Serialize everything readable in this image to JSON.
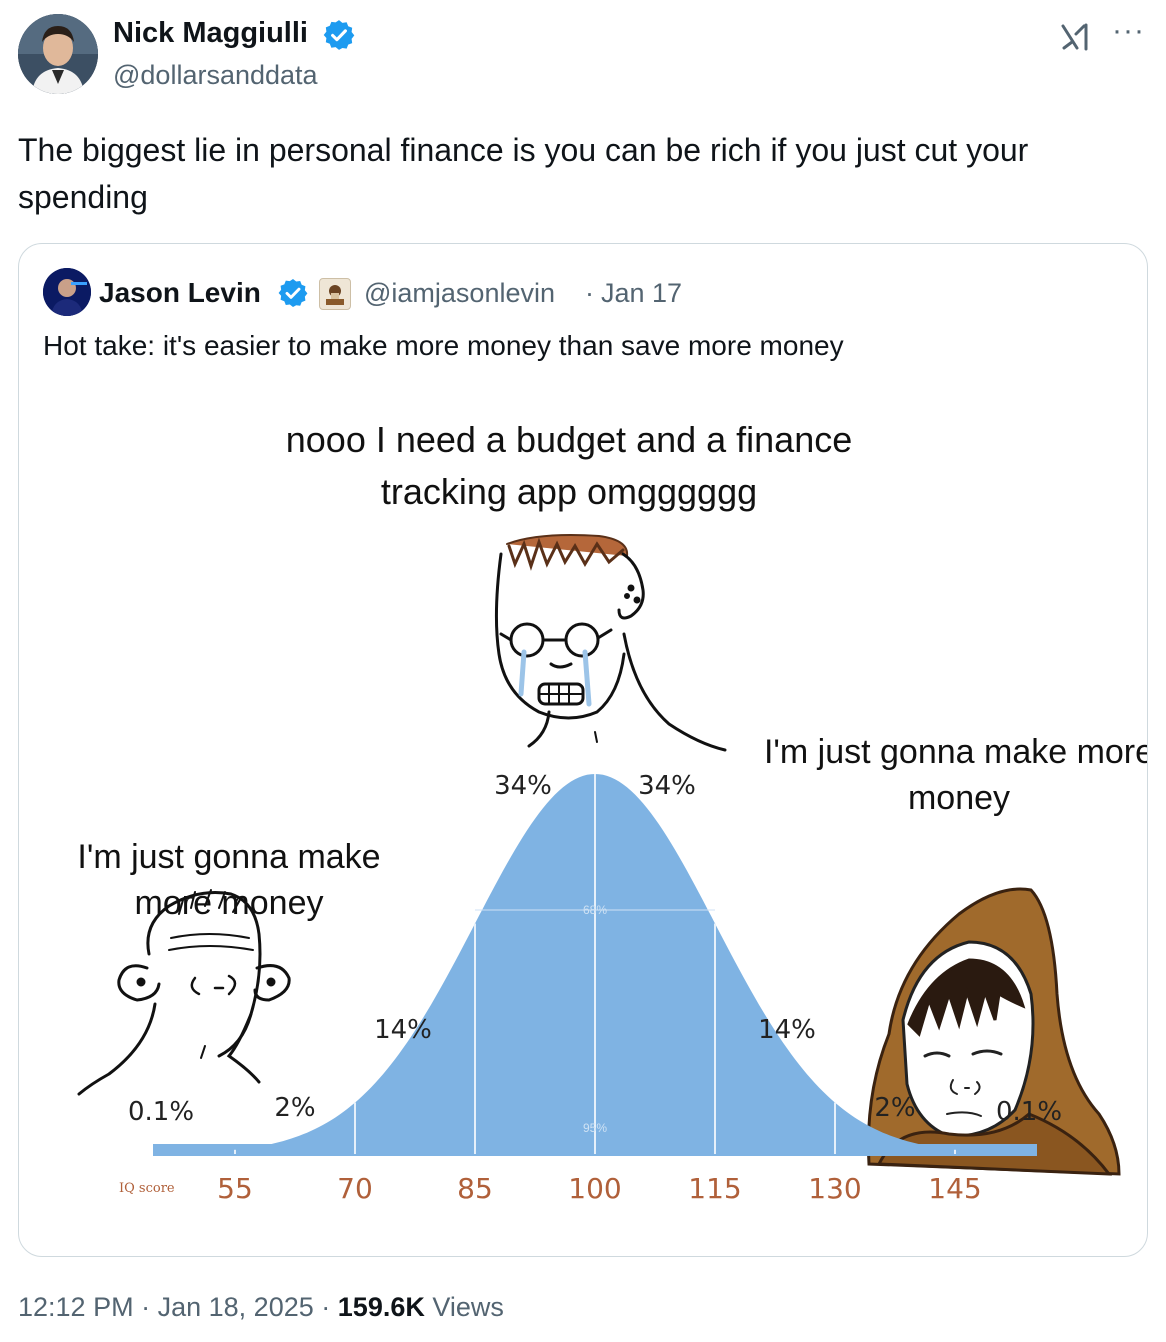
{
  "author": {
    "name": "Nick Maggiulli",
    "handle": "@dollarsanddata"
  },
  "header": {
    "logo_icon": "grok-icon",
    "more_label": "···"
  },
  "tweet": {
    "text": "The biggest lie in personal finance is you can be rich if you just cut your spending"
  },
  "quoted": {
    "author_name": "Jason Levin",
    "handle": "@iamjasonlevin",
    "separator": "·",
    "date": "Jan 17",
    "text": "Hot take: it's easier to make more money than save more money"
  },
  "meme": {
    "caption_top": "nooo I need a budget and a finance tracking app omgggggg",
    "caption_left": "I'm just gonna make more money",
    "caption_right": "I'm just gonna make more money",
    "axis_title": "IQ score",
    "inner_68": "68%",
    "inner_95": "95%"
  },
  "chart_data": {
    "type": "area",
    "x": [
      55,
      70,
      85,
      100,
      115,
      130,
      145
    ],
    "tick_labels": [
      "55",
      "70",
      "85",
      "100",
      "115",
      "130",
      "145"
    ],
    "xlabel": "IQ score",
    "segment_labels": [
      "0.1%",
      "2%",
      "14%",
      "34%",
      "34%",
      "14%",
      "2%",
      "0.1%"
    ],
    "mean": 100,
    "sd": 15,
    "color": "#7fb3e3"
  },
  "footer": {
    "time": "12:12 PM",
    "sep1": "·",
    "date": "Jan 18, 2025",
    "sep2": "·",
    "views_count": "159.6K",
    "views_label": "Views"
  }
}
